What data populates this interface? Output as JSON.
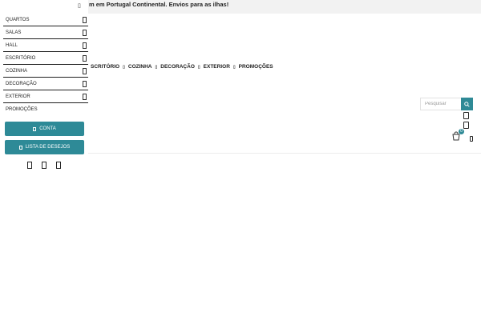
{
  "topbar": {
    "text": "m em Portugal Continental.  Envios para as ilhas!"
  },
  "mainmenu": {
    "items": [
      "SCRITÓRIO",
      "COZINHA",
      "DECORAÇÃO",
      "EXTERIOR",
      "PROMOÇÕES"
    ]
  },
  "search": {
    "placeholder": "Pesquisar"
  },
  "cart": {
    "count": "0"
  },
  "drawer": {
    "items": [
      "QUARTOS",
      "SALAS",
      "HALL",
      "ESCRITÓRIO",
      "COZINHA",
      "DECORAÇÃO",
      "EXTERIOR",
      "PROMOÇÕES"
    ],
    "account_label": "CONTA",
    "wishlist_label": "LISTA DE DESEJOS"
  },
  "colors": {
    "accent": "#2e8a97"
  }
}
